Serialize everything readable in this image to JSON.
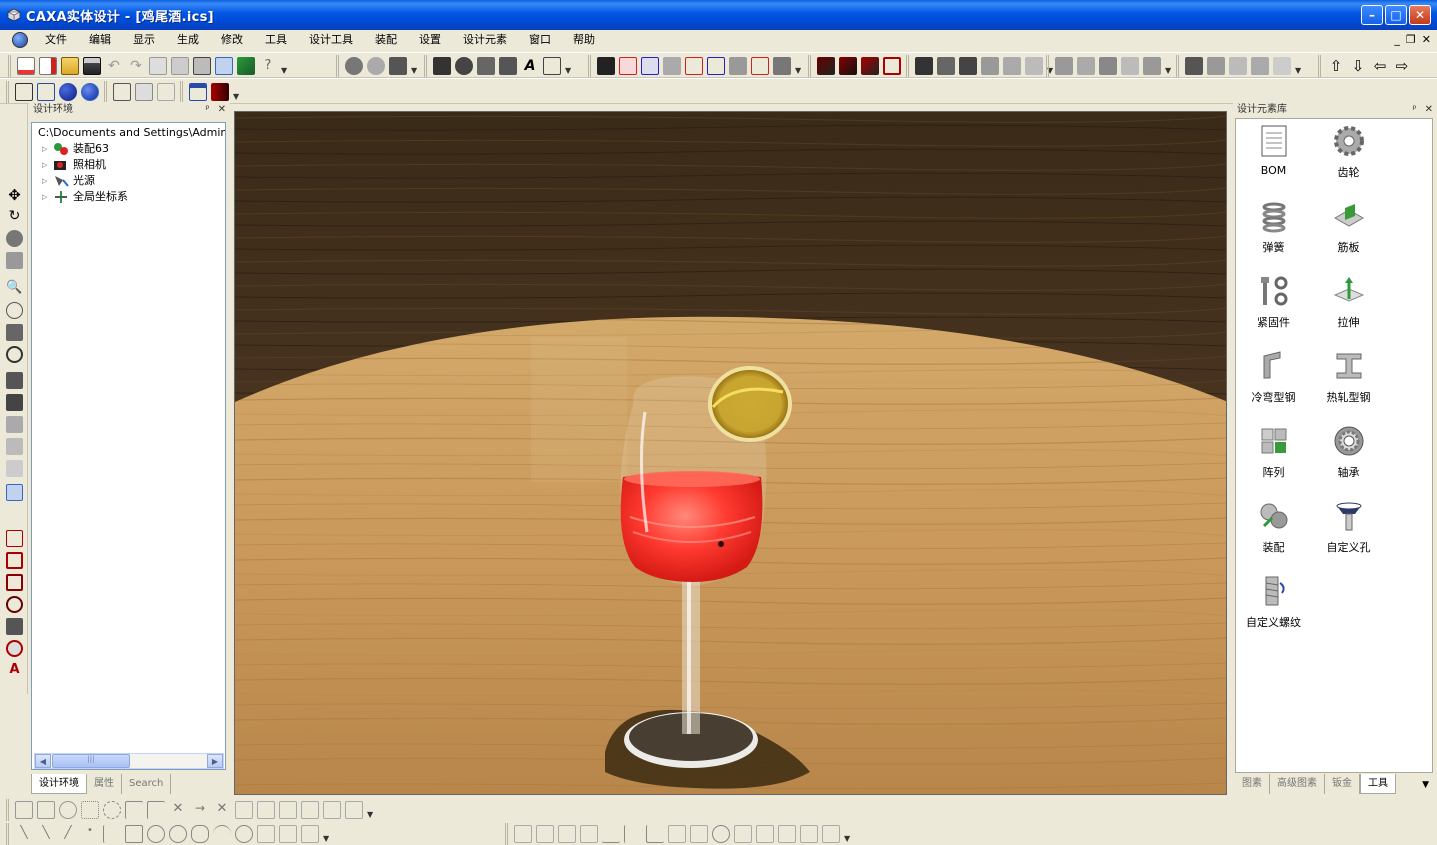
{
  "window": {
    "title": "CAXA实体设计 - [鸡尾酒.ics]",
    "min": "–",
    "max": "□",
    "close": "✕"
  },
  "menu": [
    "文件",
    "编辑",
    "显示",
    "生成",
    "修改",
    "工具",
    "设计工具",
    "装配",
    "设置",
    "设计元素",
    "窗口",
    "帮助"
  ],
  "mdi": {
    "min": "_",
    "restore": "❐",
    "close": "✕"
  },
  "design_env": {
    "title": "设计环境",
    "pin": "ᵖ",
    "close": "✕",
    "root": "C:\\Documents and Settings\\Admini",
    "nodes": [
      "装配63",
      "照相机",
      "光源",
      "全局坐标系"
    ],
    "scroll_thumb": "|||",
    "tabs": [
      "设计环境",
      "属性",
      "Search"
    ]
  },
  "library": {
    "title": "设计元素库",
    "pin": "ᵖ",
    "close": "✕",
    "items": [
      "BOM",
      "齿轮",
      "弹簧",
      "筋板",
      "紧固件",
      "拉伸",
      "冷弯型钢",
      "热轧型钢",
      "阵列",
      "轴承",
      "装配",
      "自定义孔",
      "自定义螺纹"
    ],
    "tabs": [
      "图素",
      "高级图素",
      "钣金",
      "工具"
    ],
    "dropdown": "▼"
  },
  "colors": {
    "titlebar": "#0055e5",
    "liquid": "#ff2e2e",
    "wood": "#c89a5e",
    "lemon": "#e8c13a"
  }
}
